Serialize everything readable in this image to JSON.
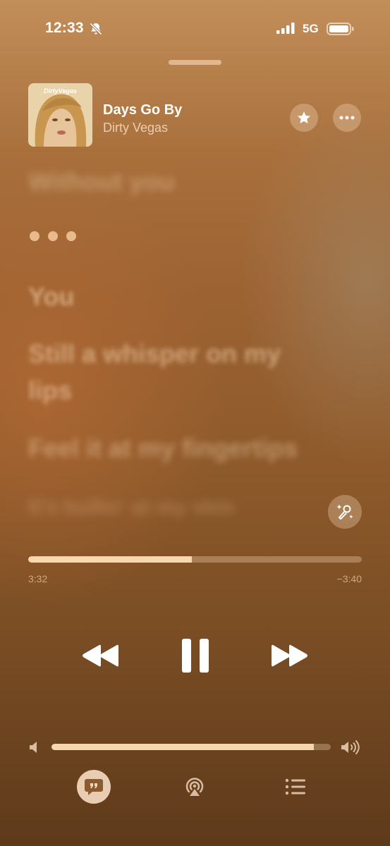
{
  "status_bar": {
    "time": "12:33",
    "network": "5G",
    "icons": [
      "bell-slash-icon",
      "signal-icon",
      "battery-icon"
    ]
  },
  "now_playing": {
    "artwork_text": "DirtyVegas",
    "title": "Days Go By",
    "artist": "Dirty Vegas",
    "favorite_icon": "star-icon",
    "more_icon": "ellipsis-icon"
  },
  "lyrics": {
    "lines": [
      "Without you",
      "You",
      "Still a whisper on my lips",
      "Feel it at my fingertips",
      "It's bullin' at my skin"
    ]
  },
  "progress": {
    "elapsed": "3:32",
    "remaining": "−3:40",
    "fraction": 0.49
  },
  "volume": {
    "fraction": 0.94
  },
  "controls": {
    "icons": [
      "rewind-icon",
      "pause-icon",
      "fast-forward-icon",
      "sing-microphone-icon",
      "lyrics-quote-icon",
      "airplay-icon",
      "queue-list-icon"
    ]
  },
  "colors": {
    "accent": "#ffe1b9",
    "background_top": "#c28e59",
    "background_bottom": "#5e3a1b"
  }
}
